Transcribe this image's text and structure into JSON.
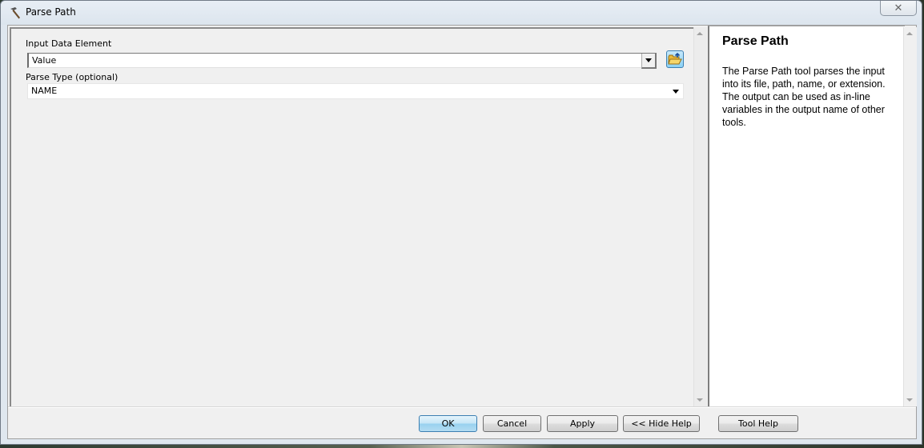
{
  "window": {
    "title": "Parse Path",
    "title_icon": "hammer-icon",
    "close_icon": "close-icon"
  },
  "parameters": {
    "input_data_element": {
      "label": "Input Data Element",
      "value": "Value",
      "browse_icon": "open-folder-icon"
    },
    "parse_type": {
      "label": "Parse Type (optional)",
      "value": "NAME"
    }
  },
  "help": {
    "title": "Parse Path",
    "body": "The Parse Path tool parses the input into its file, path, name, or extension. The output can be used as in-line variables in the output name of other tools."
  },
  "buttons": {
    "ok": "OK",
    "cancel": "Cancel",
    "apply": "Apply",
    "hide_help": "<< Hide Help",
    "tool_help": "Tool Help"
  },
  "colors": {
    "ok_accent": "#3c7fb1",
    "dialog_bg": "#f0f0f0"
  }
}
